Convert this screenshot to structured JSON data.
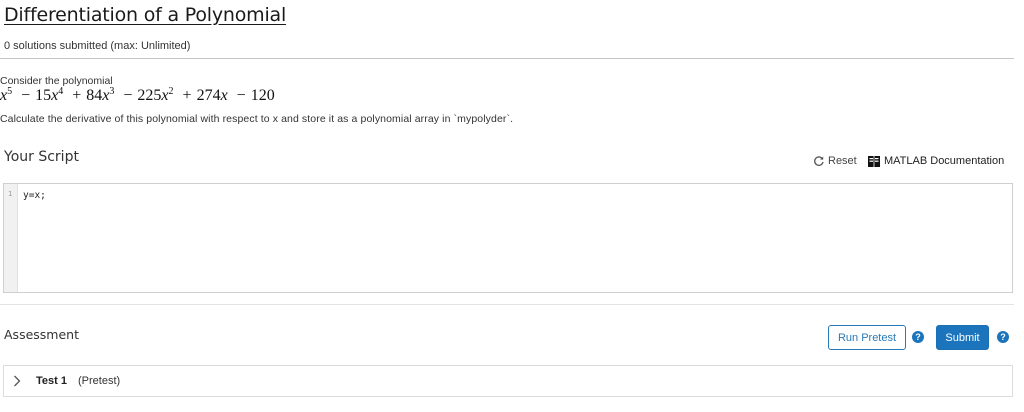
{
  "header": {
    "title": "Differentiation of a Polynomial",
    "submitted": "0 solutions submitted (max: Unlimited)"
  },
  "problem": {
    "intro": "Consider the polynomial",
    "polynomial": {
      "terms": [
        {
          "sign": "",
          "coef": "",
          "var": "x",
          "exp": "5"
        },
        {
          "sign": "−",
          "coef": "15",
          "var": "x",
          "exp": "4"
        },
        {
          "sign": "+",
          "coef": "84",
          "var": "x",
          "exp": "3"
        },
        {
          "sign": "−",
          "coef": "225",
          "var": "x",
          "exp": "2"
        },
        {
          "sign": "+",
          "coef": "274",
          "var": "x",
          "exp": ""
        },
        {
          "sign": "−",
          "coef": "120",
          "var": "",
          "exp": ""
        }
      ]
    },
    "instruction": "Calculate the derivative of this polynomial with respect to x and store it as a polynomial array in `mypolyder`."
  },
  "script": {
    "heading": "Your Script",
    "reset_label": "Reset",
    "docs_label": "MATLAB Documentation",
    "lines": [
      {
        "number": "1",
        "code": "y=x;"
      }
    ]
  },
  "assessment": {
    "heading": "Assessment",
    "run_pretest_label": "Run Pretest",
    "submit_label": "Submit",
    "help_glyph": "?",
    "tests": [
      {
        "name": "Test 1",
        "kind": "(Pretest)"
      }
    ]
  },
  "colors": {
    "accent": "#1c75bc",
    "border": "#cfcfcf",
    "text": "#222222"
  },
  "icons": {
    "reset": "reset-icon",
    "docs": "book-icon",
    "help": "help-icon",
    "expand": "chevron-right-icon"
  }
}
